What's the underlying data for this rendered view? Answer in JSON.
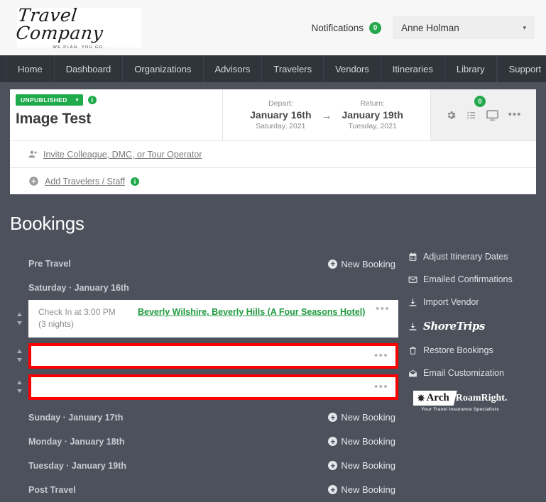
{
  "brand": {
    "name": "Travel Company",
    "tagline": "WE PLAN. YOU GO."
  },
  "topbar": {
    "notifications_label": "Notifications",
    "notifications_count": "0",
    "user_name": "Anne Holman",
    "caret": "▾"
  },
  "nav": {
    "items": [
      {
        "label": "Home"
      },
      {
        "label": "Dashboard"
      },
      {
        "label": "Organizations"
      },
      {
        "label": "Advisors"
      },
      {
        "label": "Travelers"
      },
      {
        "label": "Vendors"
      },
      {
        "label": "Itineraries"
      },
      {
        "label": "Library"
      }
    ],
    "support_label": "Support"
  },
  "itinerary": {
    "status": "UNPUBLISHED",
    "status_caret": "▾",
    "info_glyph": "i",
    "title": "Image Test",
    "depart": {
      "label": "Depart:",
      "date": "January 16th",
      "weekday_year": "Saturday, 2021"
    },
    "arrow": "→",
    "return": {
      "label": "Return:",
      "date": "January 19th",
      "weekday_year": "Tuesday, 2021"
    },
    "tools": {
      "checklist_badge": "0",
      "more_glyph": "•••"
    },
    "invite_link": "Invite Colleague, DMC, or Tour Operator",
    "add_travelers_link": "Add Travelers / Staff"
  },
  "bookings": {
    "heading": "Bookings",
    "new_booking_label": "New Booking",
    "plus_glyph": "+",
    "dots_glyph": "•••",
    "sections": [
      {
        "id": "pre-travel",
        "label": "Pre Travel",
        "has_new_booking": true,
        "rows": []
      },
      {
        "id": "saturday-january-16th",
        "label": "Saturday · January 16th",
        "has_new_booking": false,
        "rows": [
          {
            "flagged": false,
            "time": "Check In at 3:00 PM",
            "duration": "(3 nights)",
            "name": "Beverly Wilshire, Beverly Hills (A Four Seasons Hotel)"
          },
          {
            "flagged": true,
            "time": "",
            "duration": "",
            "name": ""
          },
          {
            "flagged": true,
            "time": "",
            "duration": "",
            "name": ""
          }
        ]
      },
      {
        "id": "sunday-january-17th",
        "label": "Sunday · January 17th",
        "has_new_booking": true,
        "rows": []
      },
      {
        "id": "monday-january-18th",
        "label": "Monday · January 18th",
        "has_new_booking": true,
        "rows": []
      },
      {
        "id": "tuesday-january-19th",
        "label": "Tuesday · January 19th",
        "has_new_booking": true,
        "rows": []
      },
      {
        "id": "post-travel",
        "label": "Post Travel",
        "has_new_booking": true,
        "rows": []
      }
    ]
  },
  "right_menu": {
    "items": [
      {
        "id": "adjust-itinerary-dates",
        "label": "Adjust Itinerary Dates",
        "icon": "calendar-icon"
      },
      {
        "id": "emailed-confirmations",
        "label": "Emailed Confirmations",
        "icon": "envelope-icon"
      },
      {
        "id": "import-vendor",
        "label": "Import Vendor",
        "icon": "download-icon"
      },
      {
        "id": "shoretrips",
        "label": "ShoreTrips",
        "icon": "download-icon",
        "logo": true
      },
      {
        "id": "restore-bookings",
        "label": "Restore Bookings",
        "icon": "trash-icon"
      },
      {
        "id": "email-customization",
        "label": "Email Customization",
        "icon": "envelope-open-icon"
      }
    ],
    "partner": {
      "arch": "Arch",
      "roamright": "RoamRight.",
      "tagline": "Your Travel Insurance Specialists"
    }
  },
  "colors": {
    "accent_green": "#1faa4b",
    "link_green": "#1f9b3f",
    "flag_red": "#fa0000",
    "page_bg": "#4c515c",
    "nav_bg": "#2f353b"
  }
}
